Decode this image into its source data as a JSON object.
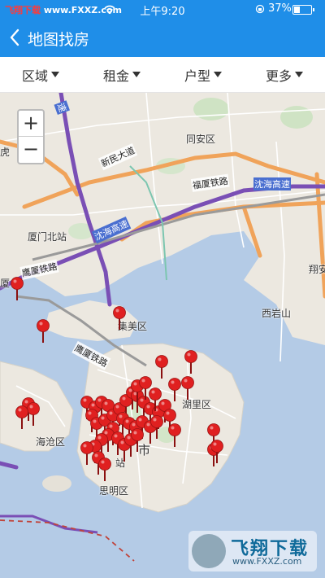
{
  "status_bar": {
    "carrier_part1": "飞翔下载",
    "carrier_part2": " www.FXXZ.com",
    "time": "上午9:20",
    "battery_percent": "37%",
    "battery_level": 0.37
  },
  "nav": {
    "title": "地图找房"
  },
  "filters": [
    {
      "label": "区域"
    },
    {
      "label": "租金"
    },
    {
      "label": "户型"
    },
    {
      "label": "更多"
    }
  ],
  "map": {
    "zoom_in": "+",
    "zoom_out": "−",
    "places": {
      "tongan": "同安区",
      "jimei": "集美区",
      "huli": "湖里区",
      "haicang": "海沧区",
      "siming": "思明区",
      "xiamen_north": "厦门北站",
      "xianan": "翔安",
      "xiyan": "西岩山",
      "city": "市",
      "station": "站",
      "hu": "虎",
      "fu": "厦"
    },
    "roads": {
      "xinmin": "新民大道",
      "fuxia_rail": "福厦铁路",
      "shenhai_1": "沈海高速",
      "shenhai_2": "沈海高速",
      "yingxia_1": "鹰厦铁路",
      "yingxia_2": "鹰厦铁路",
      "speed": "速"
    },
    "colors": {
      "pin": "#e02020",
      "highway": "#f0a35a",
      "expressway": "#7a4fb5",
      "water": "#b4cbe6",
      "land": "#ece8e0"
    }
  },
  "watermark": {
    "title": "飞翔下载",
    "url": "www.FXXZ.com"
  }
}
